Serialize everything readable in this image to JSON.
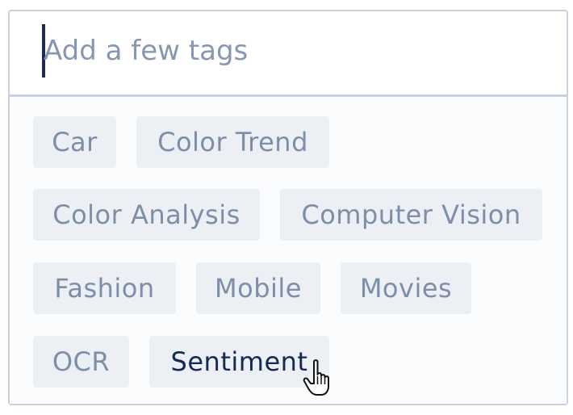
{
  "input": {
    "value": "",
    "placeholder": "Add a few tags"
  },
  "tags": [
    {
      "label": "Car"
    },
    {
      "label": "Color Trend"
    },
    {
      "label": "Color Analysis"
    },
    {
      "label": "Computer Vision"
    },
    {
      "label": "Fashion"
    },
    {
      "label": "Mobile"
    },
    {
      "label": "Movies"
    },
    {
      "label": "OCR"
    },
    {
      "label": "Sentiment",
      "hovered": true
    }
  ],
  "colors": {
    "placeholder": "#8797b0",
    "tag_text": "#7d8ea9",
    "tag_text_hover": "#132a52",
    "tag_background": "#eceff4",
    "caret": "#1c2b52"
  },
  "cursor": "hand-pointer-icon"
}
